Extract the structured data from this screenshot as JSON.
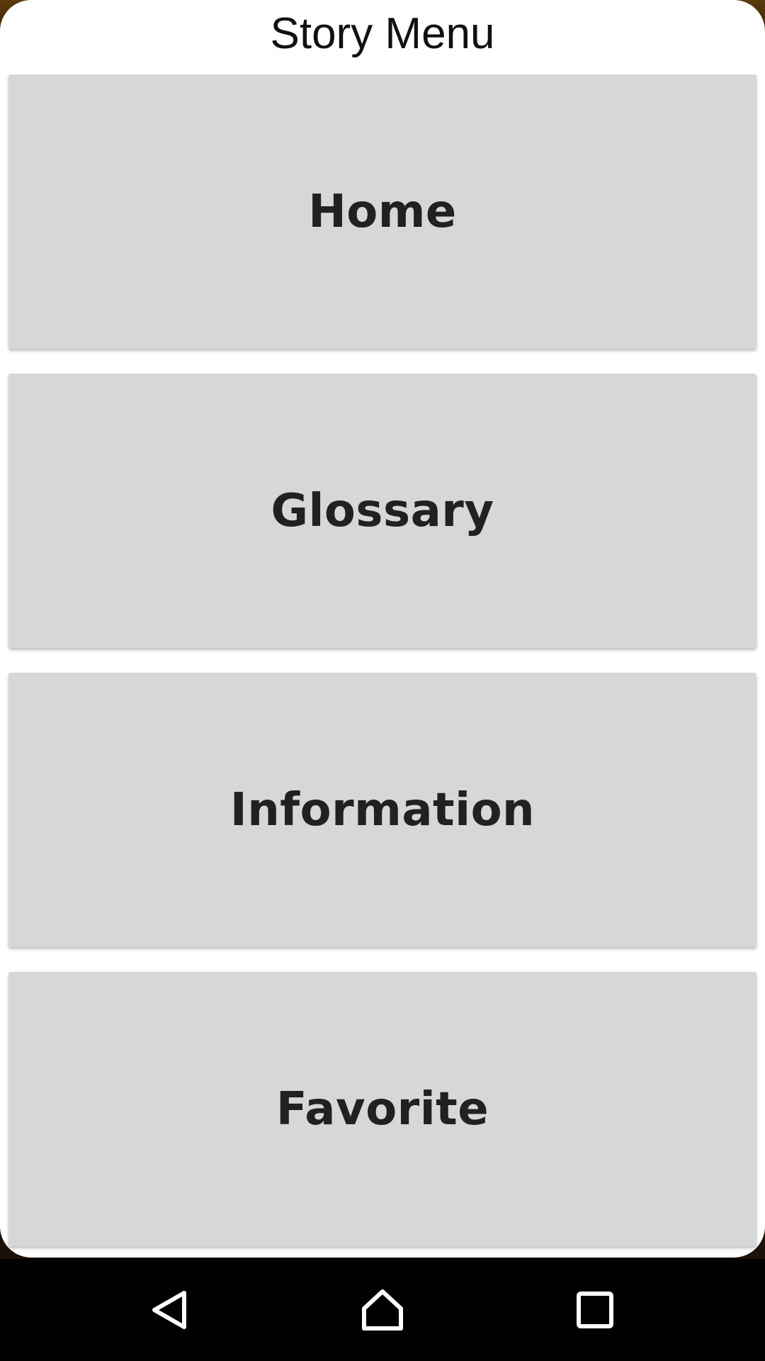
{
  "dialog": {
    "title": "Story Menu"
  },
  "menu": {
    "items": [
      {
        "label": "Home"
      },
      {
        "label": "Glossary"
      },
      {
        "label": "Information"
      },
      {
        "label": "Favorite"
      }
    ]
  },
  "nav_bar": {
    "back_icon": "back-triangle-icon",
    "home_icon": "home-icon",
    "recents_icon": "recents-square-icon"
  },
  "colors": {
    "button_bg": "#d6d7d7",
    "button_text": "#202122",
    "dialog_bg": "#ffffff",
    "nav_bg": "#000000"
  }
}
